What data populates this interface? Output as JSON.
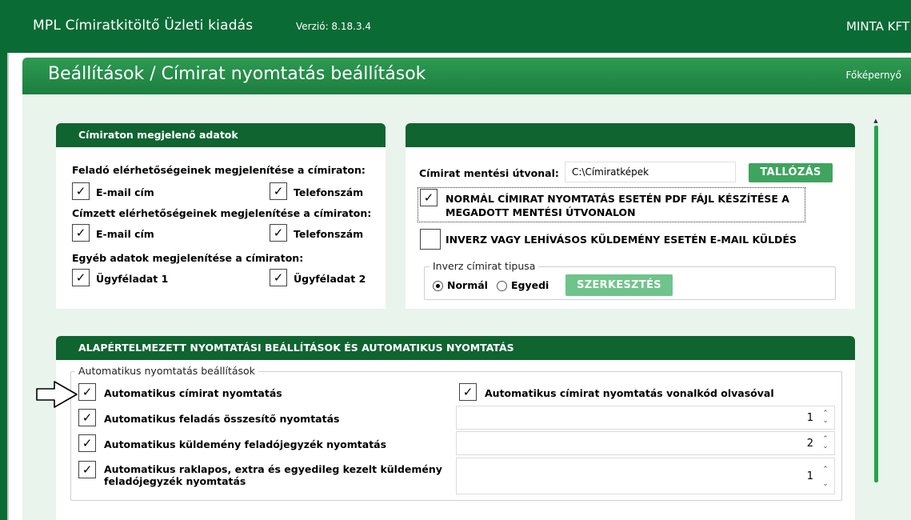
{
  "app": {
    "title": "MPL Címiratkitöltő Üzleti kiadás",
    "version": "Verzió: 8.18.3.4",
    "company": "MINTA KFT"
  },
  "header": {
    "title": "Beállítások / Címirat nyomtatás beállítások",
    "home_link": "Főképernyő"
  },
  "left_panel": {
    "title": "Címiraton megjelenő adatok",
    "sender_label": "Feladó elérhetőségeinek megjelenítése a címiraton:",
    "sender_email": "E-mail cím",
    "sender_phone": "Telefonszám",
    "recipient_label": "Címzett elérhetőségeinek megjelenítése a címiraton:",
    "recipient_email": "E-mail cím",
    "recipient_phone": "Telefonszám",
    "other_label": "Egyéb adatok megjelenítése a címiraton:",
    "client_data_1": "Ügyféladat 1",
    "client_data_2": "Ügyféladat 2"
  },
  "right_panel": {
    "title": "",
    "save_path_label": "Címirat mentési útvonal:",
    "save_path_value": "C:\\Címiratképek",
    "browse_button": "TALLÓZÁS",
    "pdf_option": "NORMÁL CÍMIRAT NYOMTATÁS ESETÉN PDF FÁJL KÉSZÍTÉSE A MEGADOTT MENTÉSI ÚTVONALON",
    "email_option": "INVERZ VAGY LEHÍVÁSOS KÜLDEMÉNY ESETÉN E-MAIL KÜLDÉS",
    "inverse_type_legend": "Inverz címirat tipusa",
    "radio_normal": "Normál",
    "radio_custom": "Egyedi",
    "edit_button": "SZERKESZTÉS"
  },
  "bottom_panel": {
    "title": "ALAPÉRTELMEZETT NYOMTATÁSI BEÁLLÍTÁSOK ÉS AUTOMATIKUS NYOMTATÁS",
    "group_legend": "Automatikus nyomtatás beállítások",
    "auto_label_print": "Automatikus címirat nyomtatás",
    "auto_label_barcode": "Automatikus címirat nyomtatás vonalkód olvasóval",
    "auto_summary": "Automatikus feladás összesítő nyomtatás",
    "auto_summary_count": "1",
    "auto_manifest": "Automatikus küldemény feladójegyzék nyomtatás",
    "auto_manifest_count": "2",
    "auto_pallet": "Automatikus raklapos, extra és egyedileg kezelt küldemény feladójegyzék nyomtatás",
    "auto_pallet_count": "1"
  },
  "colors": {
    "titlebar": "#0b6b35",
    "header": "#1f8a45",
    "panel_head": "#0f6430",
    "button": "#3fa45e",
    "background": "#e9f4ec"
  },
  "checkbox_mark": "✓",
  "spin_up": "⌃",
  "spin_down": "⌄"
}
